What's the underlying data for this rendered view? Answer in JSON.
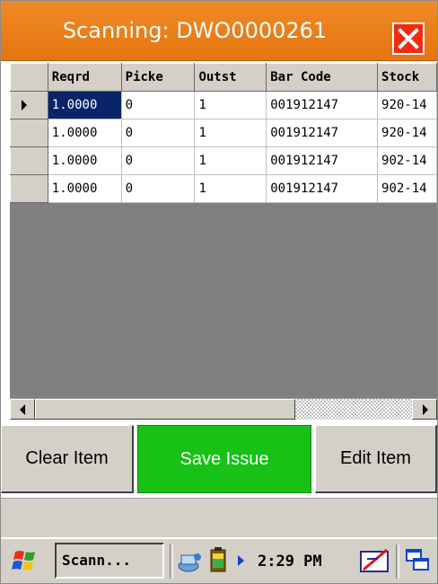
{
  "window": {
    "title": "Scanning: DWO0000261",
    "close_label": "X"
  },
  "grid": {
    "columns": [
      "Reqrd",
      "Picke",
      "Outst",
      "Bar Code",
      "Stock"
    ],
    "rows": [
      {
        "reqrd": "1.0000",
        "picked": "0",
        "outst": "1",
        "barcode": "001912147",
        "stock": "920-14"
      },
      {
        "reqrd": "1.0000",
        "picked": "0",
        "outst": "1",
        "barcode": "001912147",
        "stock": "920-14"
      },
      {
        "reqrd": "1.0000",
        "picked": "0",
        "outst": "1",
        "barcode": "001912147",
        "stock": "902-14"
      },
      {
        "reqrd": "1.0000",
        "picked": "0",
        "outst": "1",
        "barcode": "001912147",
        "stock": "902-14"
      }
    ]
  },
  "buttons": {
    "clear": "Clear Item",
    "save": "Save Issue",
    "edit": "Edit Item"
  },
  "taskbar": {
    "task_label": "Scann...",
    "clock": "2:29 PM"
  },
  "colors": {
    "titlebar": "#ec7c16",
    "close": "#ef2b10",
    "save_button": "#17c116",
    "selected_cell": "#0a246a",
    "grid_background": "#808080"
  },
  "icons": [
    "close-icon",
    "windows-start-icon",
    "network-icon",
    "battery-icon",
    "pen-input-icon",
    "switch-windows-icon"
  ]
}
